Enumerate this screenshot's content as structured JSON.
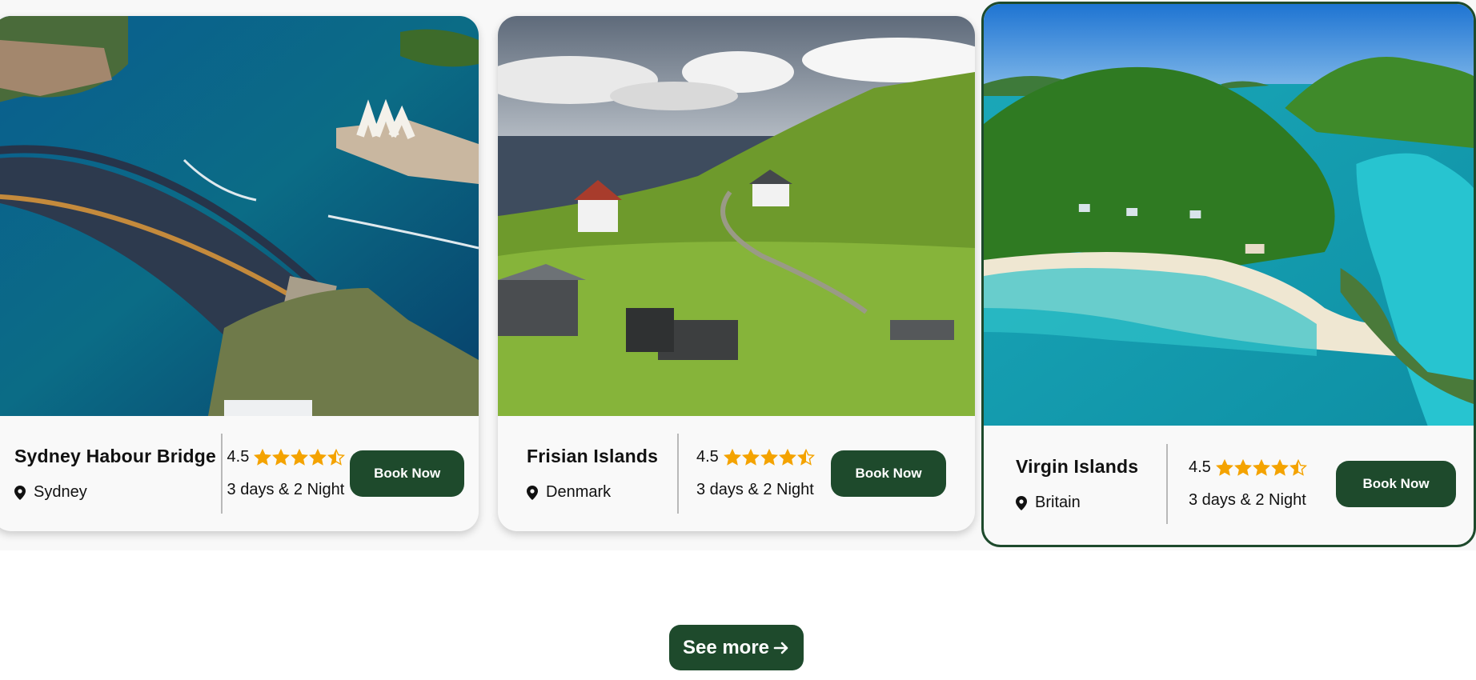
{
  "cards": [
    {
      "name": "Sydney Habour Bridge",
      "location": "Sydney",
      "rating": "4.5",
      "rating_value": 4.5,
      "duration": "3 days & 2 Night",
      "button": "Book Now",
      "selected": false
    },
    {
      "name": "Frisian Islands",
      "location": "Denmark",
      "rating": "4.5",
      "rating_value": 4.5,
      "duration": "3 days & 2 Night",
      "button": "Book Now",
      "selected": false
    },
    {
      "name": "Virgin Islands",
      "location": "Britain",
      "rating": "4.5",
      "rating_value": 4.5,
      "duration": "3 days & 2 Night",
      "button": "Book Now",
      "selected": true
    }
  ],
  "see_more": {
    "label": "See more",
    "icon": "arrow-right-icon"
  },
  "colors": {
    "accent": "#1e4a2c",
    "star": "#f4a300",
    "selected_border": "#1e4a2c"
  }
}
